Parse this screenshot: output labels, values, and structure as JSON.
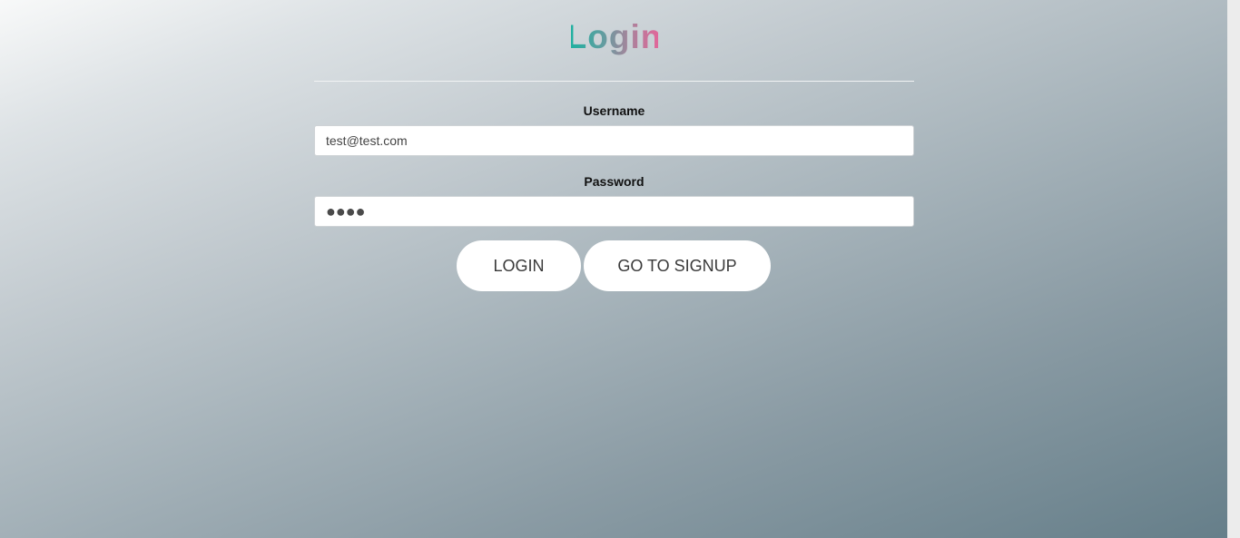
{
  "form": {
    "title": "Login",
    "username_label": "Username",
    "username_value": "test@test.com",
    "password_label": "Password",
    "password_value": "●●●●",
    "login_button": "LOGIN",
    "signup_button": "GO TO SIGNUP"
  },
  "colors": {
    "title_gradient_start": "#1fb0a0",
    "title_gradient_end": "#e0689a",
    "background_light": "#f8f9f9",
    "background_dark": "#657e89",
    "button_bg": "#ffffff"
  }
}
